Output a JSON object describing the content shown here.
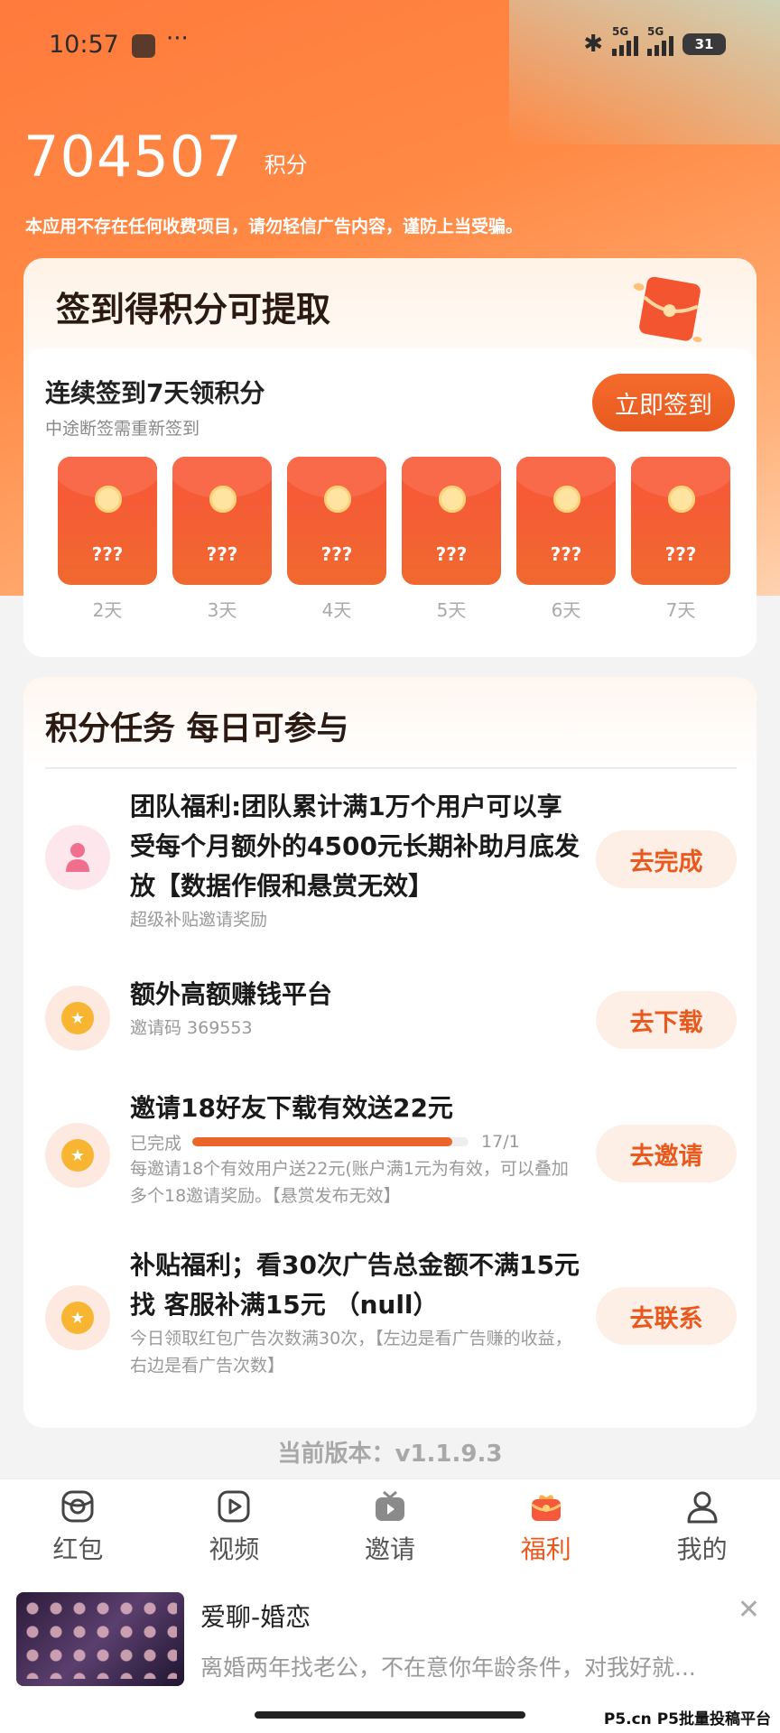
{
  "status_bar": {
    "time": "10:57",
    "dots": "···",
    "signal_1_label": "5G",
    "signal_2_label": "5G",
    "battery": "31"
  },
  "points": {
    "value": "704507",
    "unit": "积分"
  },
  "notice": "本应用不存在任何收费项目，请勿轻信广告内容，谨防上当受骗。",
  "checkin": {
    "title": "签到得积分可提取",
    "heading": "连续签到7天领积分",
    "subheading": "中途断签需重新签到",
    "button_label": "立即签到",
    "days": [
      {
        "reward": "???",
        "label": "2天"
      },
      {
        "reward": "???",
        "label": "3天"
      },
      {
        "reward": "???",
        "label": "4天"
      },
      {
        "reward": "???",
        "label": "5天"
      },
      {
        "reward": "???",
        "label": "6天"
      },
      {
        "reward": "???",
        "label": "7天"
      }
    ]
  },
  "tasks": {
    "title": "积分任务  每日可参与",
    "items": [
      {
        "icon": "user-icon",
        "title": "团队福利:团队累计满1万个用户可以享受每个月额外的4500元长期补助月底发放【数据作假和悬赏无效】",
        "subtitle": "超级补贴邀请奖励",
        "button": "去完成"
      },
      {
        "icon": "star-icon",
        "title": "额外高额赚钱平台",
        "subtitle": "邀请码  369553",
        "button": "去下载"
      },
      {
        "icon": "star-icon",
        "title": "邀请18好友下载有效送22元",
        "progress_label": "已完成",
        "progress_text": "17/1",
        "progress_fraction": 0.94,
        "subtitle": "每邀请18个有效用户送22元(账户满1元为有效，可以叠加多个18邀请奖励。【悬赏发布无效】",
        "button": "去邀请"
      },
      {
        "icon": "star-icon",
        "title": "补贴福利；看30次广告总金额不满15元找 客服补满15元  （null）",
        "subtitle": "今日领取红包广告次数满30次，【左边是看广告赚的收益，右边是看广告次数】",
        "button": "去联系"
      }
    ]
  },
  "version": "当前版本：v1.1.9.3",
  "tabbar": [
    {
      "label": "红包",
      "icon": "red-packet-icon",
      "active": false
    },
    {
      "label": "视频",
      "icon": "video-icon",
      "active": false
    },
    {
      "label": "邀请",
      "icon": "tv-icon",
      "active": false
    },
    {
      "label": "福利",
      "icon": "gift-icon",
      "active": true
    },
    {
      "label": "我的",
      "icon": "profile-icon",
      "active": false
    }
  ],
  "ad": {
    "title": "爱聊-婚恋",
    "description": "离婚两年找老公，不在意你年龄条件，对我好就...",
    "close": "✕"
  },
  "watermark": "P5.cn P5批量投稿平台",
  "colors": {
    "accent": "#e9591d",
    "hero_start": "#ff7a3c",
    "red_packet": "#f8553a"
  }
}
